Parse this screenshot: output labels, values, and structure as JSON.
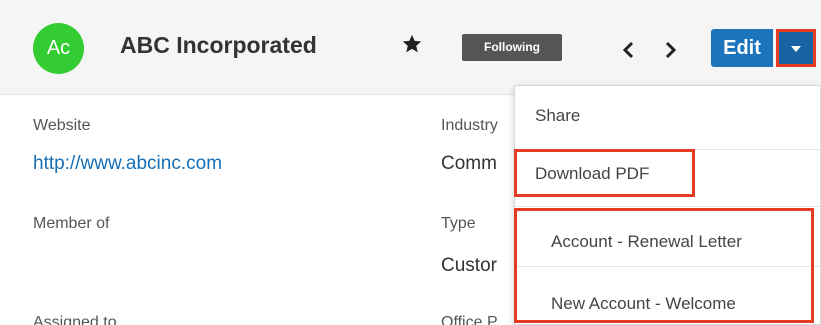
{
  "header": {
    "avatar_initials": "Ac",
    "record_name": "ABC Incorporated",
    "follow_label": "Following",
    "edit_label": "Edit"
  },
  "fields": {
    "website_label": "Website",
    "website_value": "http://www.abcinc.com",
    "industry_label": "Industry",
    "industry_value": "Comm",
    "member_of_label": "Member of",
    "type_label": "Type",
    "type_value": "Custor",
    "assigned_to_label": "Assigned to",
    "office_phone_label": "Office P"
  },
  "actions_menu": {
    "items": [
      {
        "label": "Share"
      },
      {
        "label": "Download PDF"
      },
      {
        "label": "Account - Renewal Letter"
      },
      {
        "label": "New Account - Welcome"
      }
    ]
  },
  "colors": {
    "avatar": "#33cc33",
    "primary_button": "#1c75bc",
    "highlight": "#e43b24",
    "link": "#176fb5"
  },
  "icons": [
    "star-icon",
    "chevron-left-icon",
    "chevron-right-icon",
    "caret-down-icon"
  ]
}
